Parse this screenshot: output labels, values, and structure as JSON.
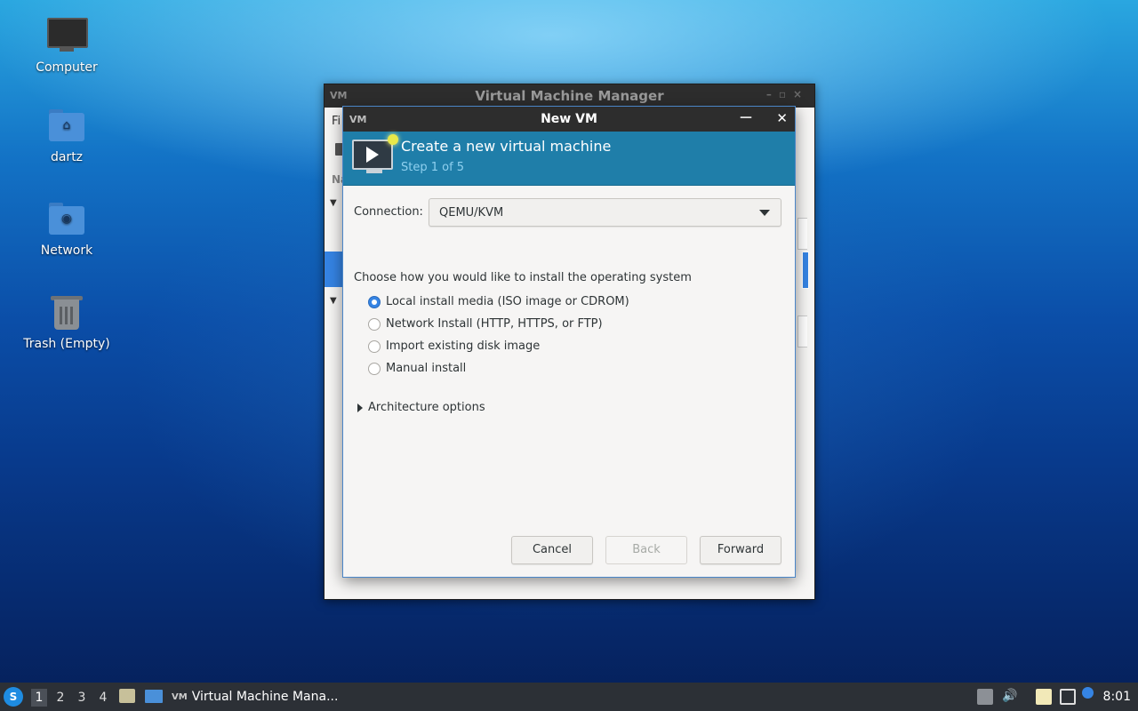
{
  "desktop": {
    "icons": [
      {
        "label": "Computer"
      },
      {
        "label": "dartz"
      },
      {
        "label": "Network"
      },
      {
        "label": "Trash (Empty)"
      }
    ]
  },
  "background_window": {
    "title": "Virtual Machine Manager",
    "logo": "VM",
    "menu_first_letters": "Fi",
    "column_header_fragment": "Na"
  },
  "dialog": {
    "title": "New VM",
    "logo": "VM",
    "banner": {
      "title": "Create a new virtual machine",
      "step": "Step 1 of 5"
    },
    "connection": {
      "label": "Connection:",
      "value": "QEMU/KVM"
    },
    "install_prompt": "Choose how you would like to install the operating system",
    "install_options": [
      {
        "label": "Local install media (ISO image or CDROM)",
        "selected": true
      },
      {
        "label": "Network Install (HTTP, HTTPS, or FTP)",
        "selected": false
      },
      {
        "label": "Import existing disk image",
        "selected": false
      },
      {
        "label": "Manual install",
        "selected": false
      }
    ],
    "architecture_expander": "Architecture options",
    "buttons": {
      "cancel": "Cancel",
      "back": "Back",
      "forward": "Forward"
    }
  },
  "taskbar": {
    "workspaces": [
      "1",
      "2",
      "3",
      "4"
    ],
    "active_workspace": "1",
    "task_logo": "VM",
    "task_label": "Virtual Machine Mana...",
    "clock": "8:01"
  },
  "colors": {
    "banner": "#1f7ea9",
    "accent": "#3584e4",
    "titlebar": "#2d2d2d",
    "taskbar": "#2c3036"
  }
}
